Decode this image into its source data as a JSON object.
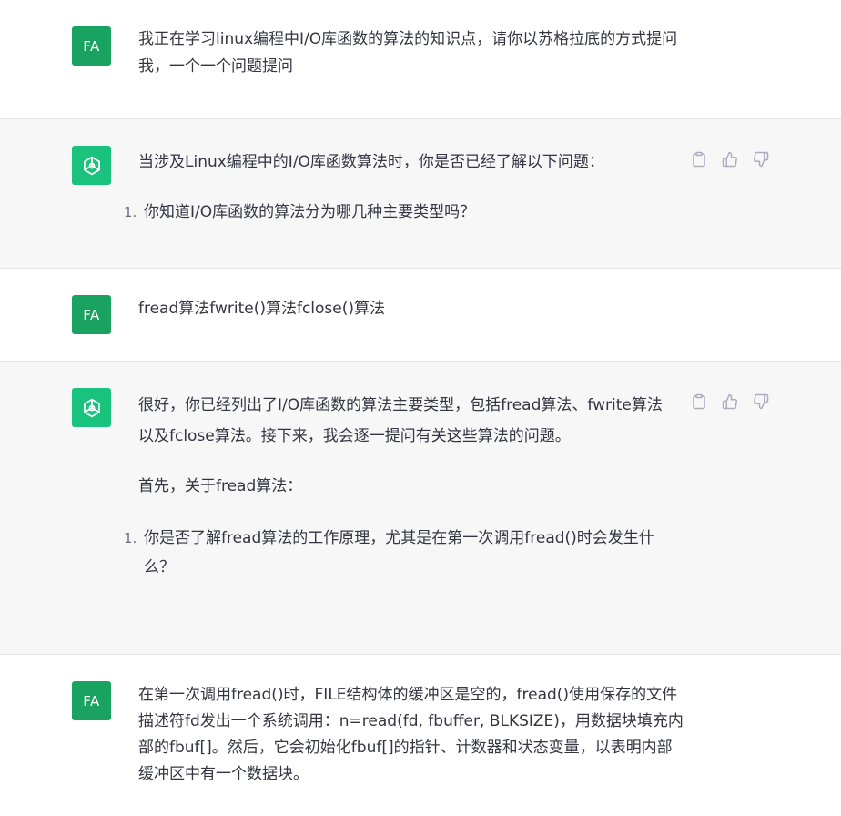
{
  "user_avatar_label": "FA",
  "messages": [
    {
      "role": "user",
      "paragraphs": [
        "我正在学习linux编程中I/O库函数的算法的知识点，请你以苏格拉底的方式提问我，一个一个问题提问"
      ]
    },
    {
      "role": "assistant",
      "paragraphs": [
        "当涉及Linux编程中的I/O库函数算法时，你是否已经了解以下问题："
      ],
      "list": [
        {
          "num": "1.",
          "text": "你知道I/O库函数的算法分为哪几种主要类型吗？"
        }
      ]
    },
    {
      "role": "user",
      "paragraphs": [
        "fread算法fwrite()算法fclose()算法"
      ]
    },
    {
      "role": "assistant",
      "paragraphs": [
        "很好，你已经列出了I/O库函数的算法主要类型，包括fread算法、fwrite算法以及fclose算法。接下来，我会逐一提问有关这些算法的问题。",
        "首先，关于fread算法："
      ],
      "list": [
        {
          "num": "1.",
          "text": "你是否了解fread算法的工作原理，尤其是在第一次调用fread()时会发生什么？"
        }
      ]
    },
    {
      "role": "user",
      "paragraphs": [
        "在第一次调用fread()时，FILE结构体的缓冲区是空的，fread()使用保存的文件描述符fd发出一个系统调用：n=read(fd, fbuffer, BLKSIZE)，用数据块填充内部的fbuf[]。然后，它会初始化fbuf[]的指针、计数器和状态变量，以表明内部缓冲区中有一个数据块。"
      ]
    }
  ],
  "actions": {
    "copy_icon": "clipboard-icon",
    "like_icon": "thumbs-up-icon",
    "dislike_icon": "thumbs-down-icon",
    "icon_color": "#acacbe"
  },
  "colors": {
    "user_avatar_bg": "#1aa260",
    "bot_avatar_bg": "#19c37d",
    "assistant_bg": "#f7f7f8"
  }
}
